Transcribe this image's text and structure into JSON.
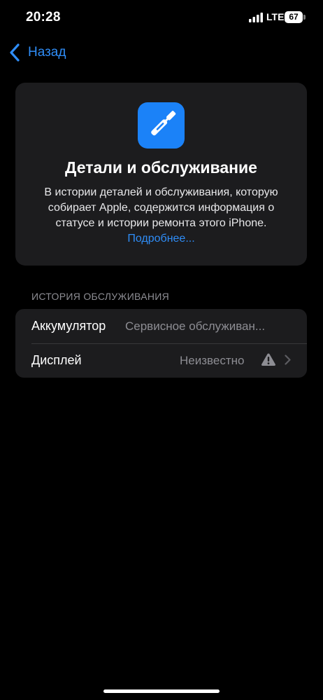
{
  "status_bar": {
    "time": "20:28",
    "network": "LTE",
    "battery": "67"
  },
  "nav": {
    "back_label": "Назад"
  },
  "card": {
    "title": "Детали и обслуживание",
    "description": "В истории деталей и обслуживания, которую собирает Apple, содержится информация о статусе и истории ремонта этого iPhone.",
    "link": "Подробнее..."
  },
  "service_history": {
    "header": "ИСТОРИЯ ОБСЛУЖИВАНИЯ",
    "rows": [
      {
        "label": "Аккумулятор",
        "value": "Сервисное обслуживан..."
      },
      {
        "label": "Дисплей",
        "value": "Неизвестно",
        "icons": [
          "warning-icon",
          "chevron-right-icon"
        ]
      }
    ]
  },
  "colors": {
    "accent": "#2f8df7",
    "card_background": "#1c1c1e",
    "secondary_text": "#8d8d93",
    "app_icon": "#1b82f8"
  }
}
